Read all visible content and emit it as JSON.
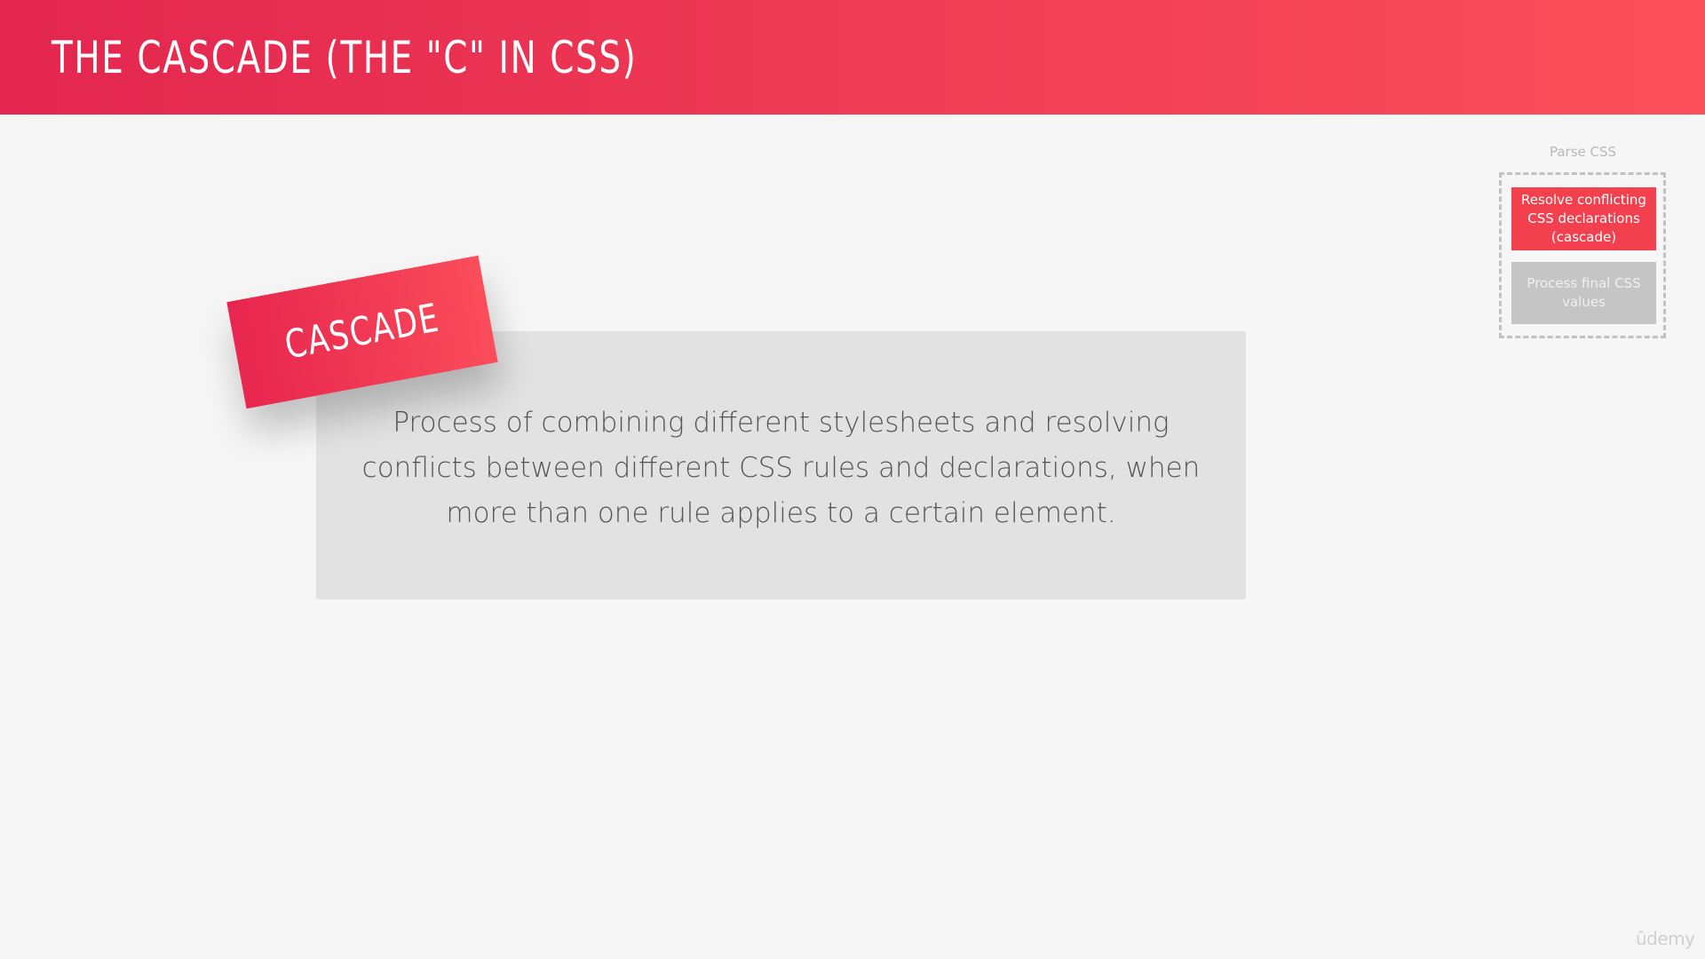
{
  "slide": {
    "title": "THE CASCADE (THE \"C\" IN CSS)"
  },
  "tag": {
    "label": "CASCADE"
  },
  "definition": {
    "lines": [
      "Process of combining different stylesheets and resolving",
      "conflicts between different CSS rules and declarations, when",
      "more than one rule applies to a certain element."
    ]
  },
  "sidebar": {
    "title": "Parse CSS",
    "steps": [
      {
        "label": "Resolve conflicting CSS declarations (cascade)",
        "state": "active"
      },
      {
        "label": "Process final CSS values",
        "state": "inactive"
      }
    ]
  },
  "watermark": {
    "text": "ûdemy"
  },
  "colors": {
    "accent": "#f2404f",
    "header_start": "#e3264f",
    "header_end": "#fb4f5a",
    "box": "#e2e2e2",
    "inactive_step": "#c5c5c5",
    "background": "#f6f6f6"
  }
}
